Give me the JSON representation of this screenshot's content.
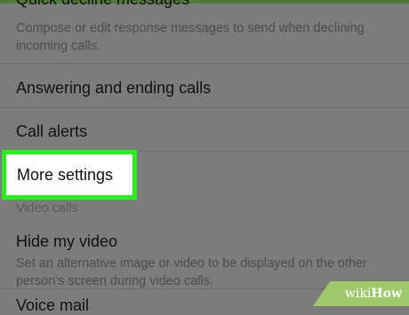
{
  "settings": {
    "quick_decline": {
      "title": "Quick decline messages",
      "desc": "Compose or edit response messages to send when declining incoming calls."
    },
    "answering": {
      "title": "Answering and ending calls"
    },
    "call_alerts": {
      "title": "Call alerts"
    },
    "more_settings": {
      "title": "More settings"
    },
    "video_calls_header": "Video calls",
    "hide_video": {
      "title": "Hide my video",
      "desc": "Set an alternative image or video to be displayed on the other person's screen during video calls."
    },
    "voice_mail": {
      "title": "Voice mail"
    }
  },
  "watermark": {
    "wiki": "wiki",
    "how": "How"
  },
  "colors": {
    "highlight_border": "#27f01b",
    "watermark_bg": "#9dc96a",
    "dim_bg": "#7c7c7c"
  }
}
